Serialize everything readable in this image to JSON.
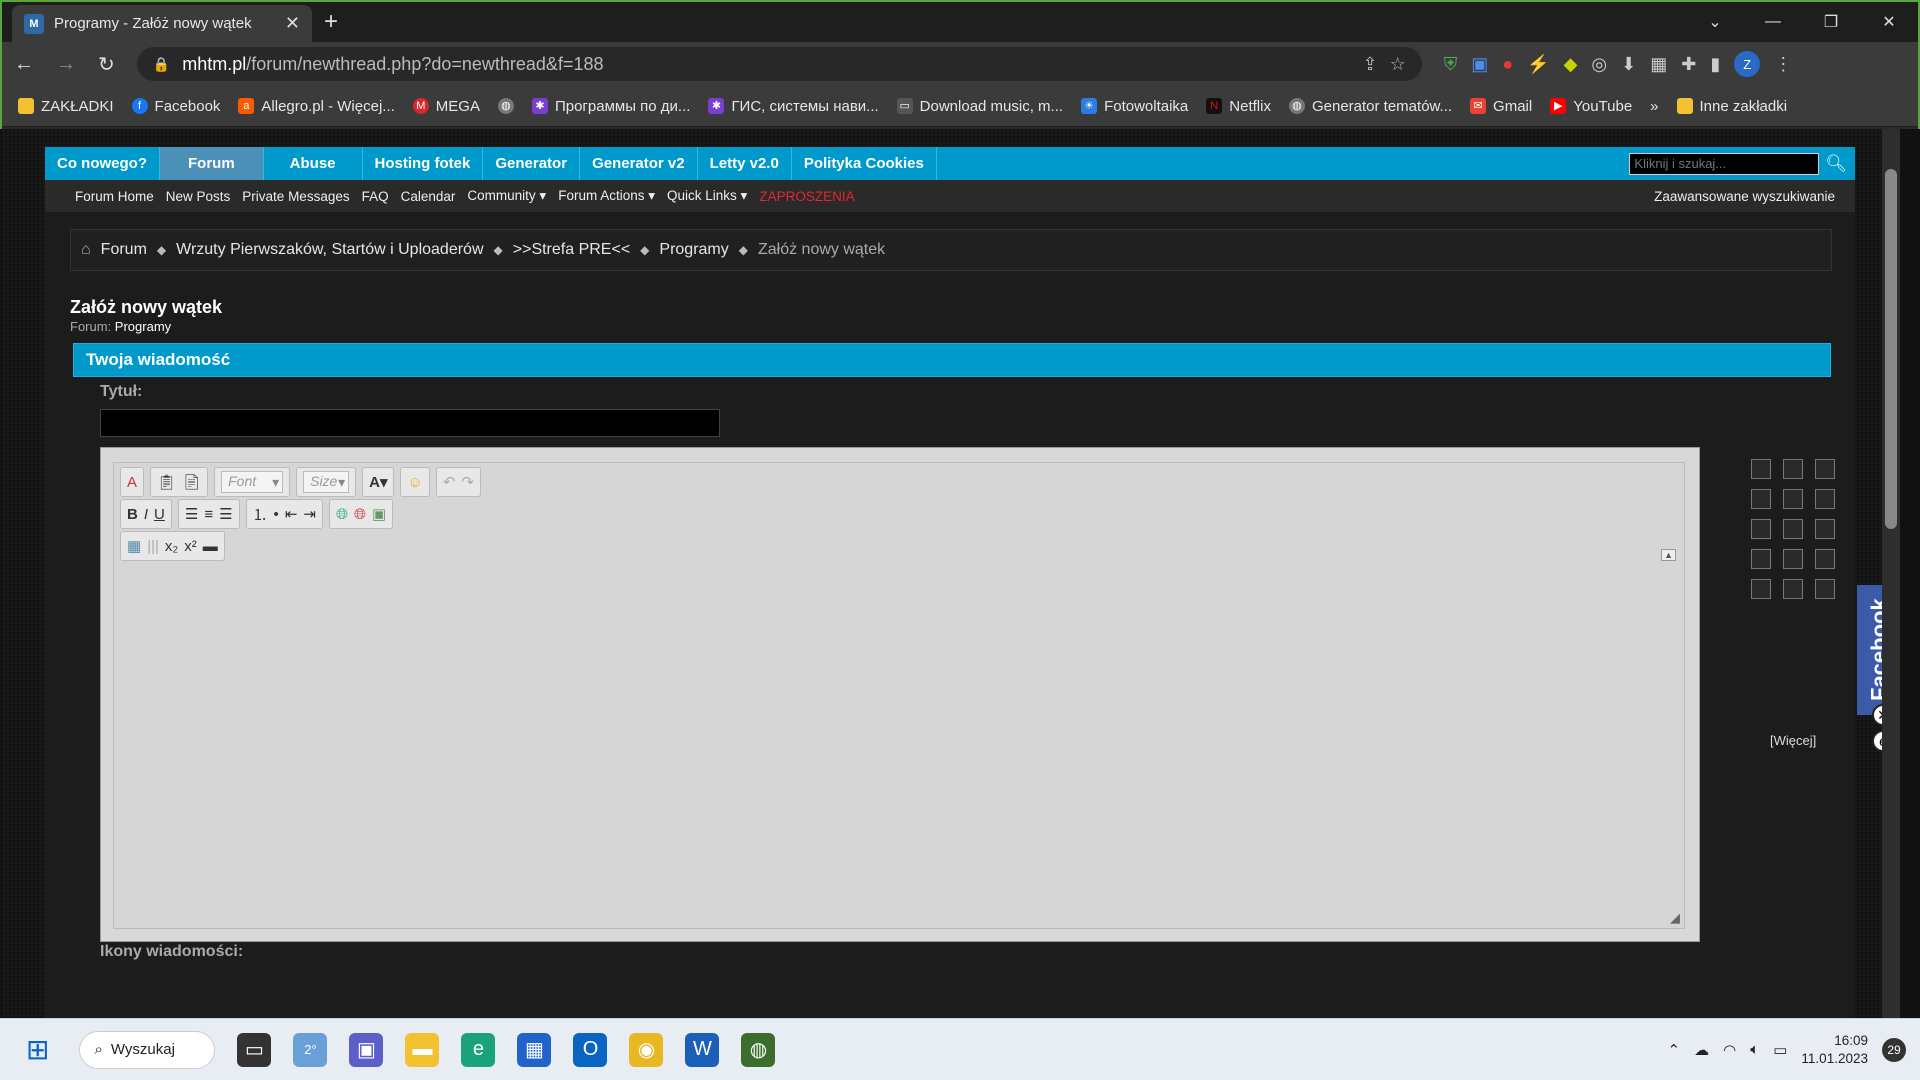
{
  "browser": {
    "tab_title": "Programy - Załóż nowy wątek",
    "url_host": "mhtm.pl",
    "url_path": "/forum/newthread.php?do=newthread&f=188",
    "profile_initial": "Z",
    "bookmarks": [
      "ZAKŁADKI",
      "Facebook",
      "Allegro.pl - Więcej...",
      "MEGA",
      "",
      "Программы по ди...",
      "ГИС, системы нави...",
      "Download music, m...",
      "Fotowoltaika",
      "Netflix",
      "Generator tematów...",
      "Gmail",
      "YouTube"
    ],
    "bookmarks_more": "»",
    "other_bookmarks": "Inne zakładki"
  },
  "nav": {
    "items": [
      "Co nowego?",
      "Forum",
      "Abuse",
      "Hosting fotek",
      "Generator",
      "Generator v2",
      "Letty v2.0",
      "Polityka Cookies"
    ],
    "search_placeholder": "Kliknij i szukaj...",
    "sub": [
      "Forum Home",
      "New Posts",
      "Private Messages",
      "FAQ",
      "Calendar",
      "Community ▾",
      "Forum Actions ▾",
      "Quick Links ▾"
    ],
    "sub_highlight": "ZAPROSZENIA",
    "advanced_search": "Zaawansowane wyszukiwanie"
  },
  "breadcrumb": {
    "items": [
      "Forum",
      "Wrzuty Pierwszaków, Startów i Uploaderów",
      ">>Strefa PRE<<",
      "Programy"
    ],
    "current": "Załóż nowy wątek"
  },
  "page": {
    "title": "Załóż nowy wątek",
    "forum_label": "Forum:",
    "forum_name": "Programy",
    "panel_title": "Twoja wiadomość",
    "title_label": "Tytuł:",
    "font_placeholder": "Font",
    "size_placeholder": "Size",
    "more_smilies": "[Więcej]",
    "icons_label": "Ikony wiadomości:"
  },
  "side": {
    "facebook": "Facebook"
  },
  "taskbar": {
    "search": "Wyszukaj",
    "weather": "2°",
    "time": "16:09",
    "date": "11.01.2023",
    "notifications": "29"
  }
}
